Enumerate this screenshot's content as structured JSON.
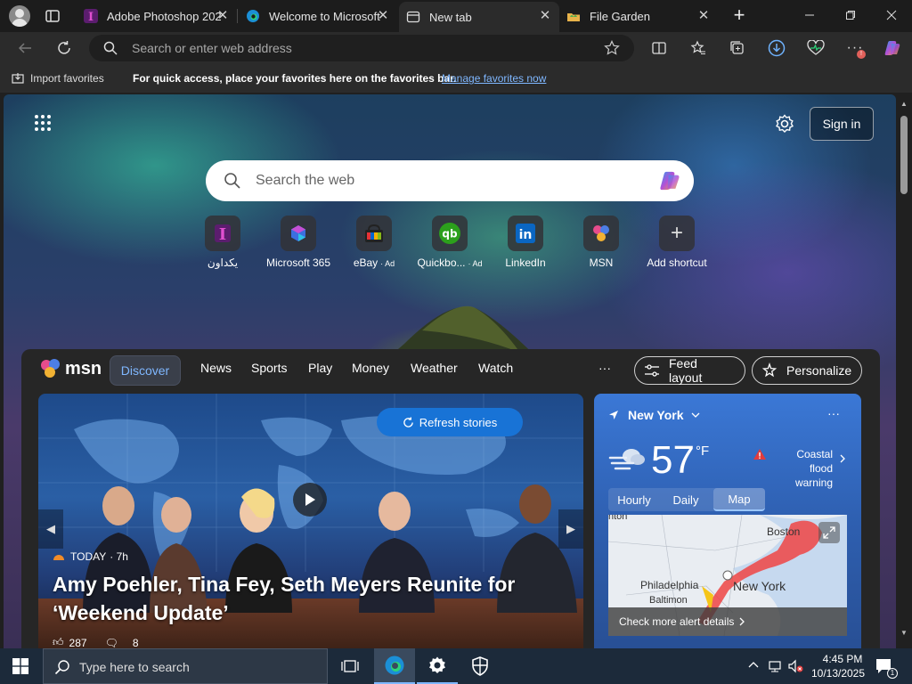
{
  "tabs": [
    {
      "title": "Adobe Photoshop 202",
      "favicon": "letter-i-icon"
    },
    {
      "title": "Welcome to Microsoft",
      "favicon": "edge-icon"
    },
    {
      "title": "New tab",
      "favicon": "newtab-icon"
    },
    {
      "title": "File Garden",
      "favicon": "file-garden-icon"
    }
  ],
  "address": {
    "placeholder": "Search or enter web address"
  },
  "favorites_bar": {
    "import": "Import favorites",
    "message": "For quick access, place your favorites here on the favorites bar.",
    "manage_link": "Manage favorites now"
  },
  "ntp": {
    "sign_in": "Sign in",
    "search_placeholder": "Search the web",
    "shortcuts": [
      {
        "label": "يكداون",
        "ad": ""
      },
      {
        "label": "Microsoft 365",
        "ad": ""
      },
      {
        "label": "eBay",
        "ad": "· Ad"
      },
      {
        "label": "Quickbo...",
        "ad": "· Ad"
      },
      {
        "label": "LinkedIn",
        "ad": ""
      },
      {
        "label": "MSN",
        "ad": ""
      },
      {
        "label": "Add shortcut",
        "ad": ""
      }
    ]
  },
  "msn": {
    "brand": "msn",
    "nav": [
      "Discover",
      "News",
      "Sports",
      "Play",
      "Money",
      "Weather",
      "Watch"
    ],
    "more": "···",
    "feed_layout": "Feed layout",
    "personalize": "Personalize",
    "hero": {
      "refresh": "Refresh stories",
      "source": "TODAY",
      "age": "· 7h",
      "title": "Amy Poehler, Tina Fey, Seth Meyers Reunite for ‘Weekend Update’",
      "likes": "287",
      "comments": "8"
    },
    "weather": {
      "location": "New York",
      "temp": "57",
      "unit": "°F",
      "alert": "Coastal flood warning",
      "tabs": [
        "Hourly",
        "Daily",
        "Map"
      ],
      "map_labels": [
        "nton",
        "Boston",
        "Philadelphia",
        "New York",
        "Baltimon"
      ],
      "alert_link": "Check more alert details"
    }
  },
  "taskbar": {
    "search_placeholder": "Type here to search",
    "time": "4:45 PM",
    "date": "10/13/2025",
    "notif_count": "1"
  },
  "colors": {
    "accent": "#1873d6",
    "link": "#7fb7ff",
    "page_bg": "#202020"
  }
}
